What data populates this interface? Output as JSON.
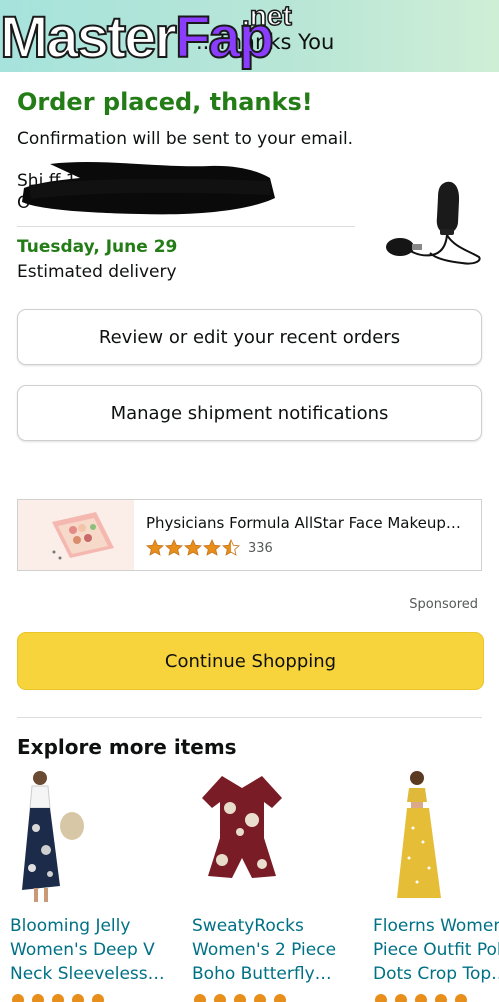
{
  "header": {
    "title": "...Thanks You",
    "watermark": "MasterFap",
    "watermark_suffix": ".net"
  },
  "order": {
    "heading": "Order placed, thanks!",
    "confirmation": "Confirmation will be sent to your email.",
    "shipping_partial": "Shi                  ff 11419",
    "shipping_line2": "O",
    "delivery_date": "Tuesday, June 29",
    "delivery_label": "Estimated delivery"
  },
  "actions": {
    "review_label": "Review or edit your recent orders",
    "manage_label": "Manage shipment notifications",
    "continue_label": "Continue Shopping"
  },
  "ad": {
    "title": "Physicians Formula AllStar Face Makeup…",
    "rating": 4.5,
    "review_count": "336",
    "sponsored_label": "Sponsored"
  },
  "explore": {
    "heading": "Explore more items",
    "items": [
      {
        "title": "Blooming Jelly\nWomen's Deep V\nNeck Sleeveless…"
      },
      {
        "title": "SweatyRocks\nWomen's 2 Piece\nBoho Butterfly…"
      },
      {
        "title": "Floerns Women\nPiece Outfit Pol\nDots Crop Top…"
      }
    ]
  },
  "colors": {
    "green": "#237c16",
    "link": "#007185",
    "button_yellow": "#f7d33c",
    "star": "#e88e1b"
  }
}
